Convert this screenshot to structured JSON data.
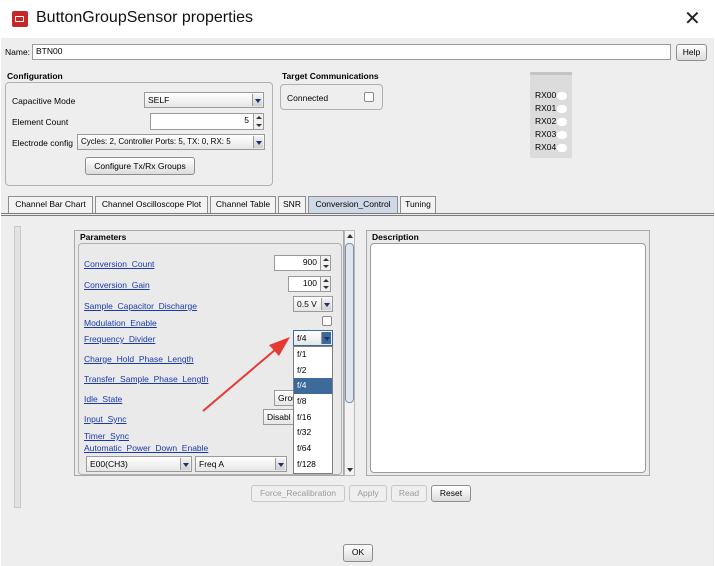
{
  "window": {
    "title": "ButtonGroupSensor properties"
  },
  "name_row": {
    "label": "Name:",
    "value": "BTN00",
    "help_label": "Help"
  },
  "configuration": {
    "title": "Configuration",
    "capacitive_mode": {
      "label": "Capacitive Mode",
      "value": "SELF"
    },
    "element_count": {
      "label": "Element Count",
      "value": "5"
    },
    "electrode_config": {
      "label": "Electrode config",
      "value": "Cycles: 2, Controller Ports: 5, TX: 0, RX: 5"
    },
    "configure_button": "Configure Tx/Rx Groups"
  },
  "target_comms": {
    "title": "Target Communications",
    "connected_label": "Connected"
  },
  "rx_indicators": [
    "RX00",
    "RX01",
    "RX02",
    "RX03",
    "RX04"
  ],
  "tabs": [
    "Channel Bar Chart",
    "Channel Oscilloscope Plot",
    "Channel Table",
    "SNR",
    "Conversion_Control",
    "Tuning"
  ],
  "parameters": {
    "title": "Parameters",
    "items": [
      {
        "label": "Conversion_Count",
        "value": "900"
      },
      {
        "label": "Conversion_Gain",
        "value": "100"
      },
      {
        "label": "Sample_Capacitor_Discharge",
        "value": "0.5 V"
      },
      {
        "label": "Modulation_Enable"
      },
      {
        "label": "Frequency_Divider",
        "value": "f/4"
      },
      {
        "label": "Charge_Hold_Phase_Length"
      },
      {
        "label": "Transfer_Sample_Phase_Length"
      },
      {
        "label": "Idle_State",
        "value": "Grou"
      },
      {
        "label": "Input_Sync",
        "value": "Disabl"
      },
      {
        "label": "Timer_Sync"
      },
      {
        "label": "Automatic_Power_Down_Enable"
      }
    ],
    "element_select": "E00(CH3)",
    "freq_select": "Freq A"
  },
  "divider_options": [
    "f/1",
    "f/2",
    "f/4",
    "f/8",
    "f/16",
    "f/32",
    "f/64",
    "f/128"
  ],
  "description": {
    "title": "Description"
  },
  "actions": {
    "force_recal": "Force_Recalibration",
    "apply": "Apply",
    "read": "Read",
    "reset": "Reset"
  },
  "ok_label": "OK",
  "colors": {
    "annotation_arrow": "#e53935",
    "selected_item": "#3d6a99",
    "link_text": "#1a3aa8"
  }
}
